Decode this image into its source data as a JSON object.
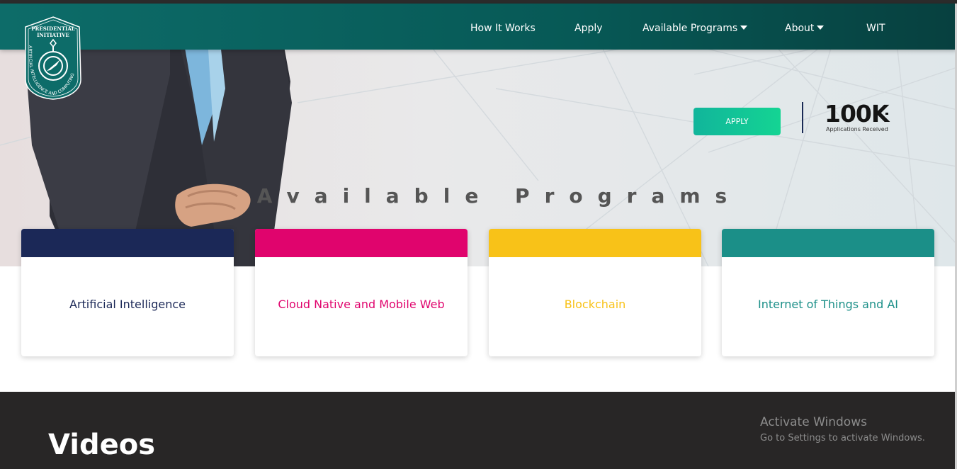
{
  "brand": {
    "logo_line1": "PRESIDENTIAL",
    "logo_line2": "INITIATIVE",
    "logo_arc": "ARTIFICIAL INTELLIGENCE AND COMPUTING",
    "primary_color": "#0a6461"
  },
  "nav": {
    "items": [
      {
        "label": "How It Works",
        "has_dropdown": false
      },
      {
        "label": "Apply",
        "has_dropdown": false
      },
      {
        "label": "Available Programs",
        "has_dropdown": true
      },
      {
        "label": "About",
        "has_dropdown": true
      },
      {
        "label": "WIT",
        "has_dropdown": false
      }
    ]
  },
  "hero": {
    "apply_label": "APPLY",
    "stat_value": "100K",
    "stat_label": "Applications Received"
  },
  "programs": {
    "title": "Available Programs",
    "cards": [
      {
        "label": "Artificial Intelligence",
        "color": "#1b2857"
      },
      {
        "label": "Cloud Native and Mobile Web",
        "color": "#e0046d"
      },
      {
        "label": "Blockchain",
        "color": "#f8c218"
      },
      {
        "label": "Internet of Things and AI",
        "color": "#1b8f88"
      }
    ]
  },
  "videos": {
    "title": "Videos"
  },
  "watermark": {
    "title": "Activate Windows",
    "subtitle": "Go to Settings to activate Windows."
  }
}
